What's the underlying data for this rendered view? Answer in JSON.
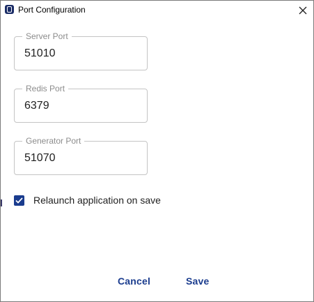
{
  "window": {
    "title": "Port Configuration"
  },
  "fields": [
    {
      "label": "Server Port",
      "value": "51010"
    },
    {
      "label": "Redis Port",
      "value": "6379"
    },
    {
      "label": "Generator Port",
      "value": "51070"
    }
  ],
  "relaunch": {
    "label": "Relaunch application on save",
    "checked": true
  },
  "actions": {
    "cancel_label": "Cancel",
    "save_label": "Save"
  },
  "colors": {
    "accent": "#1a3c8e",
    "field_border": "#c4c4c4",
    "field_label": "#8c8c8c"
  },
  "icons": {
    "app": "app-logo-icon",
    "close": "close-icon",
    "check": "check-icon"
  }
}
